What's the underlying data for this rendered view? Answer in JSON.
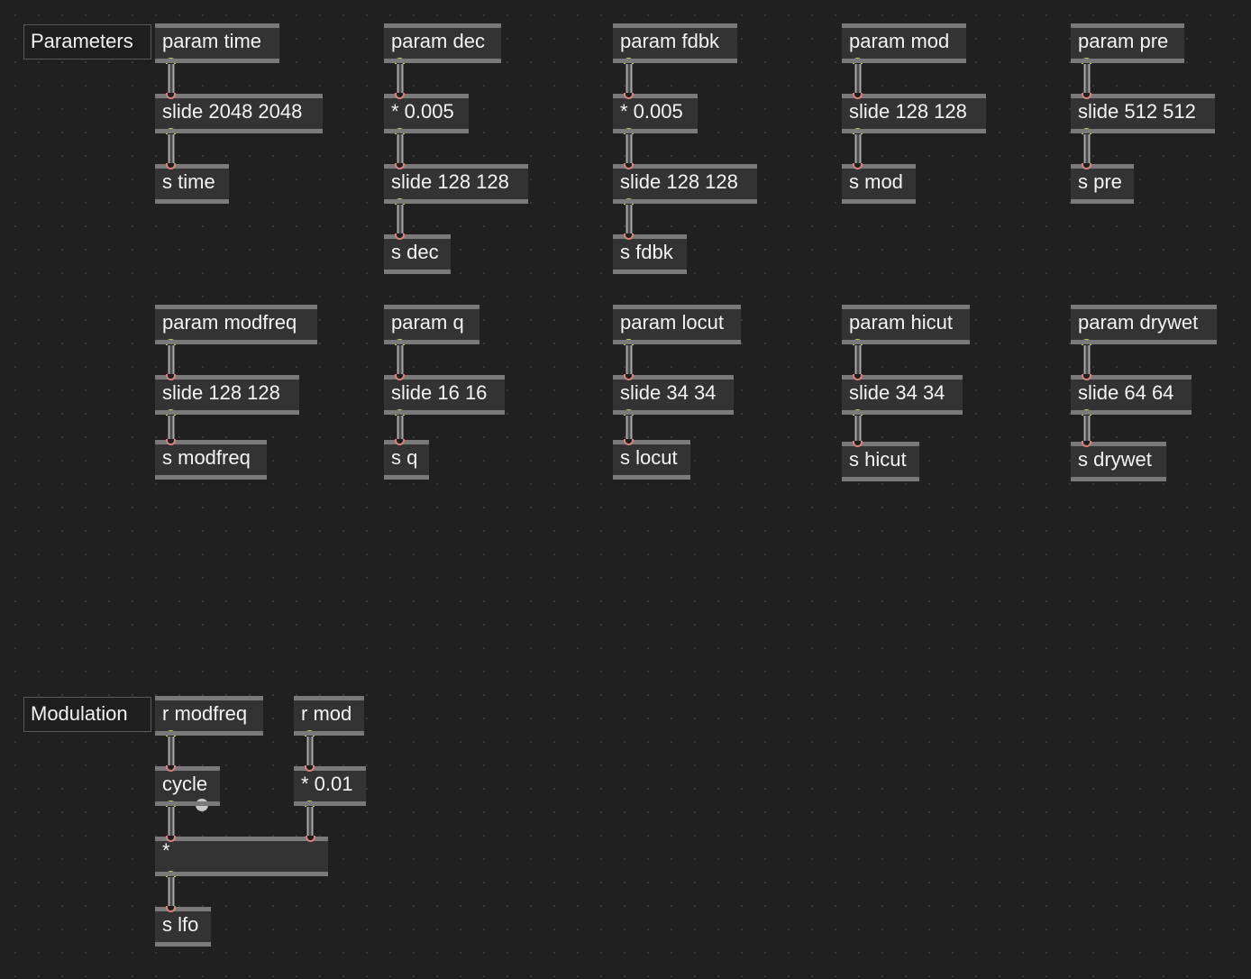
{
  "comments": {
    "parameters": "Parameters",
    "modulation": "Modulation"
  },
  "objects": {
    "param_time": "param time",
    "slide_time": "slide 2048 2048",
    "s_time": "s time",
    "param_dec": "param dec",
    "mul_dec": "* 0.005",
    "slide_dec": "slide 128 128",
    "s_dec": "s dec",
    "param_fdbk": "param fdbk",
    "mul_fdbk": "* 0.005",
    "slide_fdbk": "slide 128 128",
    "s_fdbk": "s fdbk",
    "param_mod": "param mod",
    "slide_mod": "slide 128 128",
    "s_mod": "s mod",
    "param_pre": "param pre",
    "slide_pre": "slide 512 512",
    "s_pre": "s pre",
    "param_modfreq": "param modfreq",
    "slide_modfreq": "slide 128 128",
    "s_modfreq": "s modfreq",
    "param_q": "param q",
    "slide_q": "slide 16 16",
    "s_q": "s q",
    "param_locut": "param locut",
    "slide_locut": "slide 34 34",
    "s_locut": "s locut",
    "param_hicut": "param hicut",
    "slide_hicut": "slide 34 34",
    "s_hicut": "s hicut",
    "param_drywet": "param drywet",
    "slide_drywet": "slide 64 64",
    "s_drywet": "s drywet",
    "r_modfreq": "r modfreq",
    "r_mod": "r mod",
    "cycle": "cycle",
    "mul_mod": "* 0.01",
    "mul_lfo": "*",
    "s_lfo": "s lfo"
  },
  "colors": {
    "canvas": "#202020",
    "object_fill": "#333333",
    "object_bar": "#7a7a7a",
    "inlet": "#d9817b",
    "outlet": "#c9d25a",
    "cord": "#a8a8a8"
  }
}
